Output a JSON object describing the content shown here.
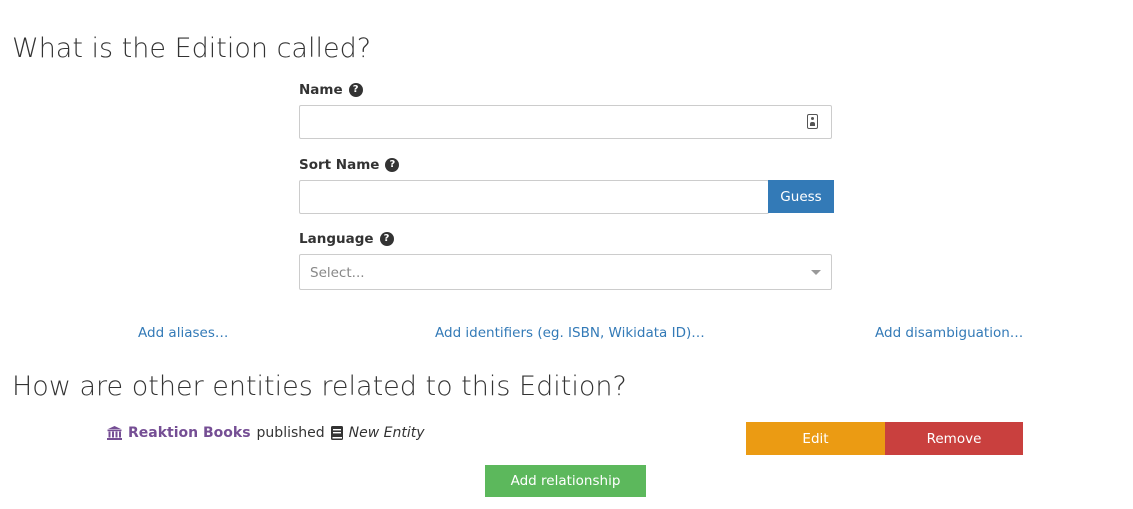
{
  "sections": {
    "name_heading": "What is the Edition called?",
    "relationships_heading": "How are other entities related to this Edition?"
  },
  "fields": {
    "name": {
      "label": "Name",
      "value": ""
    },
    "sort_name": {
      "label": "Sort Name",
      "value": "",
      "guess_label": "Guess"
    },
    "language": {
      "label": "Language",
      "placeholder": "Select..."
    }
  },
  "help_glyph": "?",
  "links": {
    "aliases": "Add aliases…",
    "identifiers": "Add identifiers (eg. ISBN, Wikidata ID)…",
    "disambiguation": "Add disambiguation…"
  },
  "relationship": {
    "source": "Reaktion Books",
    "verb": "published",
    "target": "New Entity",
    "source_icon": "bank-icon",
    "target_icon": "book-icon",
    "edit_label": "Edit",
    "remove_label": "Remove"
  },
  "add_relationship_label": "Add relationship",
  "colors": {
    "primary": "#337ab7",
    "warning": "#eb9b13",
    "danger": "#c9403e",
    "success": "#5cb85c",
    "entity": "#754e94"
  }
}
